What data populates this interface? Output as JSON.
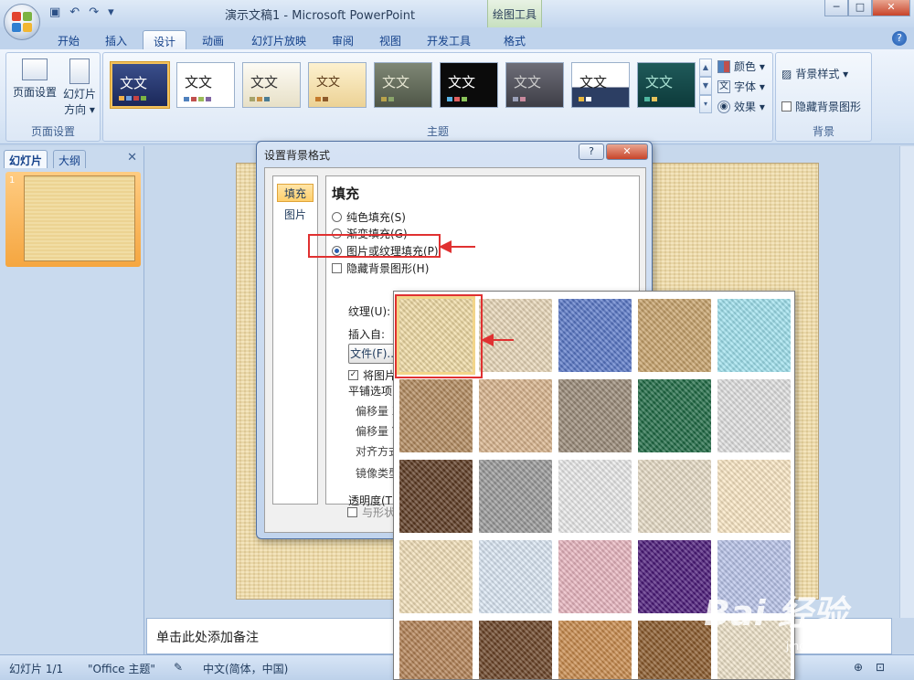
{
  "titlebar": {
    "title": "演示文稿1 - Microsoft PowerPoint",
    "context_tool": "绘图工具",
    "controls": [
      "─",
      "□",
      "✕"
    ]
  },
  "tabs": [
    "开始",
    "插入",
    "设计",
    "动画",
    "幻灯片放映",
    "审阅",
    "视图",
    "开发工具",
    "格式"
  ],
  "active_tab": "设计",
  "ribbon": {
    "page_setup": {
      "btn1": "页面设置",
      "btn2a": "幻灯片",
      "btn2b": "方向 ▾",
      "label": "页面设置"
    },
    "themes_label": "主题",
    "theme_text": "文文",
    "theme_opts": {
      "colors": "颜色 ▾",
      "fonts": "字体 ▾",
      "effects": "效果 ▾"
    },
    "background": {
      "style": "背景样式 ▾",
      "hide": "隐藏背景图形",
      "label": "背景"
    }
  },
  "left_pane": {
    "tab_slides": "幻灯片",
    "tab_outline": "大纲",
    "close": "✕",
    "slide_num": "1"
  },
  "notes_placeholder": "单击此处添加备注",
  "status": {
    "slide": "幻灯片 1/1",
    "theme": "\"Office 主题\"",
    "lang": "中文(简体，中国)"
  },
  "dialog": {
    "title": "设置背景格式",
    "help": "?",
    "close": "✕",
    "nav": [
      "填充",
      "图片"
    ],
    "heading": "填充",
    "options": {
      "solid": "纯色填充(S)",
      "gradient": "渐变填充(G)",
      "picture": "图片或纹理填充(P)",
      "hide_bg": "隐藏背景图形(H)"
    },
    "texture_label": "纹理(U):",
    "insert_from": "插入自:",
    "file_btn": "文件(F)...",
    "tile_check": "将图片平",
    "tile_options": "平铺选项",
    "offset_x": "偏移量 X",
    "offset_y": "偏移量 Y",
    "align": "对齐方式",
    "mirror": "镜像类型",
    "transparency": "透明度(T):",
    "rotate_with": "与形状一"
  },
  "textures": [
    [
      "#f0dba4",
      "#e9d7b8",
      "#5a79c9",
      "#c8a36b",
      "#9fe2ef"
    ],
    [
      "#b38a5e",
      "#d9b48c",
      "#9a8a78",
      "#1f6b45",
      "#e0e0e0"
    ],
    [
      "#5d3a22",
      "#9a9a9a",
      "#eaeaea",
      "#e7dcc6",
      "#fbe7c4"
    ],
    [
      "#f2dfb8",
      "#dbe7f4",
      "#e9b5bf",
      "#4b1a7a",
      "#b9c4ea"
    ],
    [
      "#b48255",
      "#6b4326",
      "#c98a4b",
      "#8b5a2b",
      "#eee2c8"
    ]
  ],
  "watermark": {
    "main": "Bai 经验",
    "sub": "jingyan.baidu.com"
  }
}
